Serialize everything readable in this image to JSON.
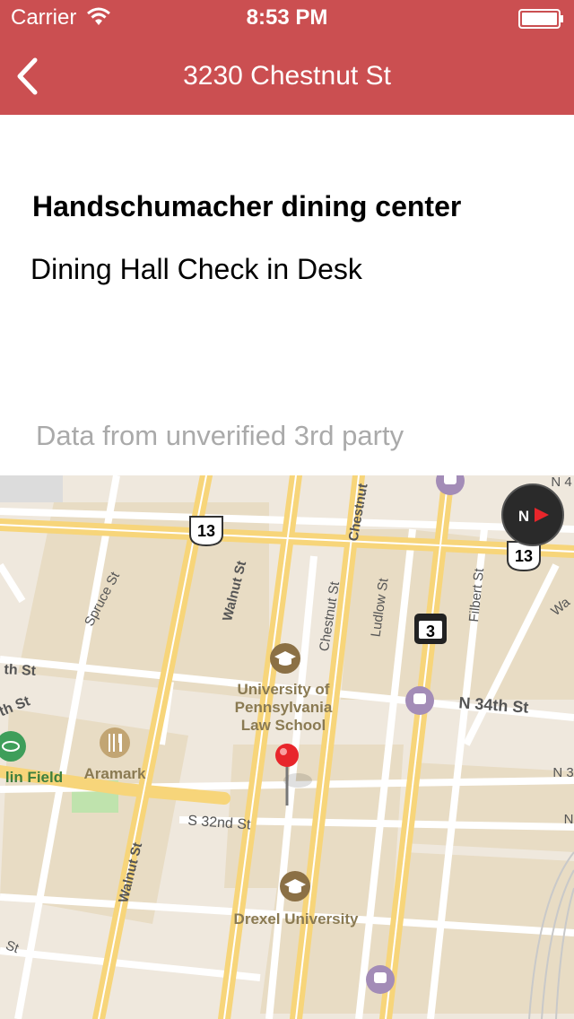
{
  "status": {
    "carrier": "Carrier",
    "time": "8:53 PM"
  },
  "nav": {
    "title": "3230 Chestnut St",
    "back_icon": "chevron-left-icon"
  },
  "place": {
    "name": "Handschumacher dining center",
    "description": "Dining Hall Check in Desk",
    "source_note": "Data from unverified 3rd party"
  },
  "map": {
    "streets": {
      "chestnut_upper": "Chestnut",
      "chestnut": "Chestnut St",
      "walnut_upper": "Walnut St",
      "walnut_lower": "Walnut St",
      "spruce": "Spruce St",
      "ludlow": "Ludlow St",
      "filbert": "Filbert St",
      "n34": "N 34th St",
      "s32": "S 32nd St",
      "w34th": "th St",
      "w33th": "th St",
      "st_bottom": "St",
      "wa_edge": "Wa",
      "n4_top": "N 4",
      "n3_right": "N 3",
      "n_right": "N"
    },
    "places": {
      "penn_line1": "University of",
      "penn_line2": "Pennsylvania",
      "penn_line3": "Law School",
      "aramark": "Aramark",
      "field": "lin Field",
      "drexel": "Drexel University"
    },
    "shields": {
      "us13_a": "13",
      "us13_b": "13",
      "pa3": "3"
    },
    "compass": {
      "n": "N"
    },
    "colors": {
      "land": "#efe8dd",
      "block": "#e8dcc4",
      "road": "#ffffff",
      "major_road": "#f7d57a",
      "pin": "#e8262b",
      "transit": "#a38cb7"
    }
  }
}
